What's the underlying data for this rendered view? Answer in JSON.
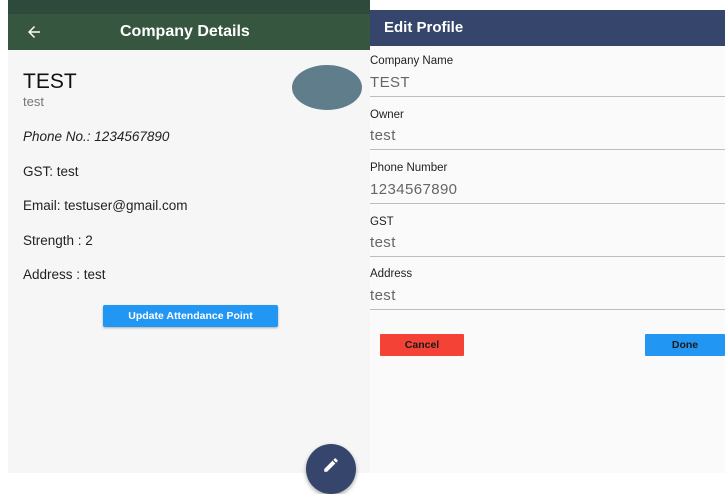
{
  "company_details": {
    "app_bar": {
      "title": "Company Details",
      "back_icon": "arrow-back-icon",
      "color": "#36563f"
    },
    "company_name": "TEST",
    "company_subtitle": "test",
    "phone": "Phone No.: 1234567890",
    "gst": "GST: test",
    "email": "Email: testuser@gmail.com",
    "strength": "Strength : 2",
    "address": "Address : test",
    "update_attendance_button": "Update Attendance Point",
    "fab_icon": "edit-pencil-icon",
    "accent_color": "#2196f3"
  },
  "edit_profile": {
    "app_bar": {
      "title": "Edit Profile",
      "color": "#36456b"
    },
    "fields": [
      {
        "label": "Company Name",
        "value": "TEST"
      },
      {
        "label": "Owner",
        "value": "test"
      },
      {
        "label": "Phone Number",
        "value": "1234567890"
      },
      {
        "label": "GST",
        "value": "test"
      },
      {
        "label": "Address",
        "value": "test"
      }
    ],
    "cancel_button": "Cancel",
    "done_button": "Done",
    "cancel_color": "#f44336",
    "done_color": "#2196f3"
  }
}
